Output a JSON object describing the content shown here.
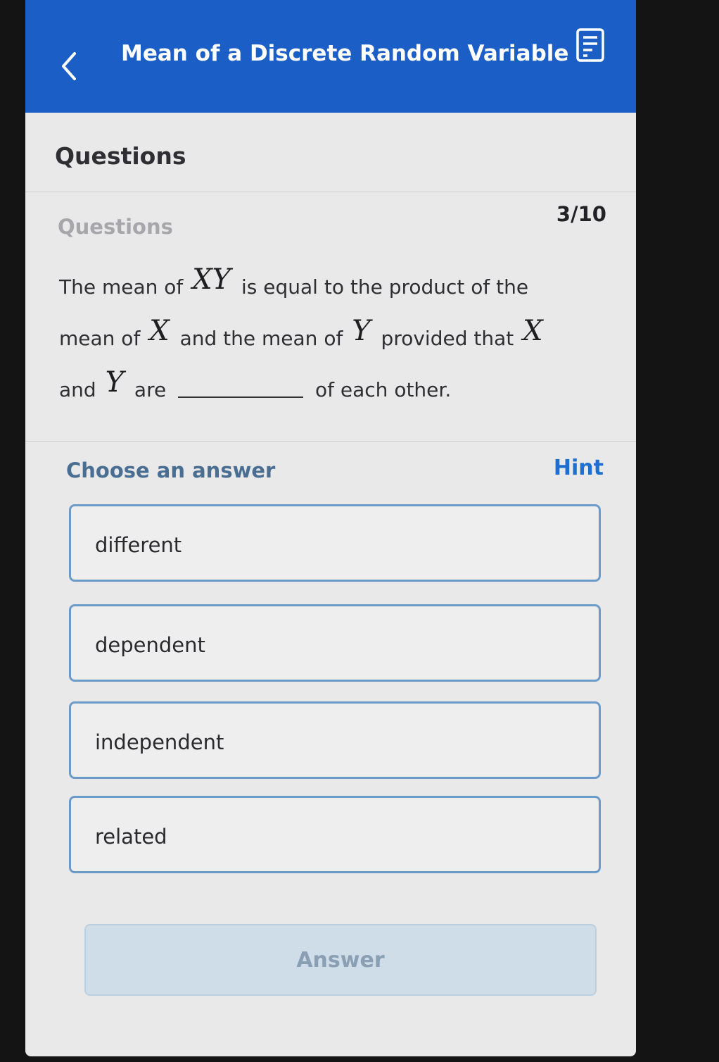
{
  "header": {
    "title": "Mean of a Discrete Random Variable",
    "back_icon": "chevron-left-icon",
    "notes_icon": "notes-icon",
    "background": "#1b5fc6"
  },
  "section": {
    "title": "Questions"
  },
  "question": {
    "label": "Questions",
    "counter": "3/10",
    "parts": {
      "t1": "The mean of",
      "m1": "XY",
      "t2": "is equal to the product of the",
      "t3": "mean of",
      "m2": "X",
      "t4": "and the mean of",
      "m3": "Y",
      "t5": "provided that",
      "m4": "X",
      "t6": "and",
      "m5": "Y",
      "t7": "are",
      "t8": "of each other."
    }
  },
  "choices": {
    "label": "Choose an answer",
    "hint": "Hint",
    "options": [
      {
        "label": "different"
      },
      {
        "label": "dependent"
      },
      {
        "label": "independent"
      },
      {
        "label": "related"
      }
    ],
    "border_color": "#6d9bc9"
  },
  "answer_button": {
    "label": "Answer"
  }
}
